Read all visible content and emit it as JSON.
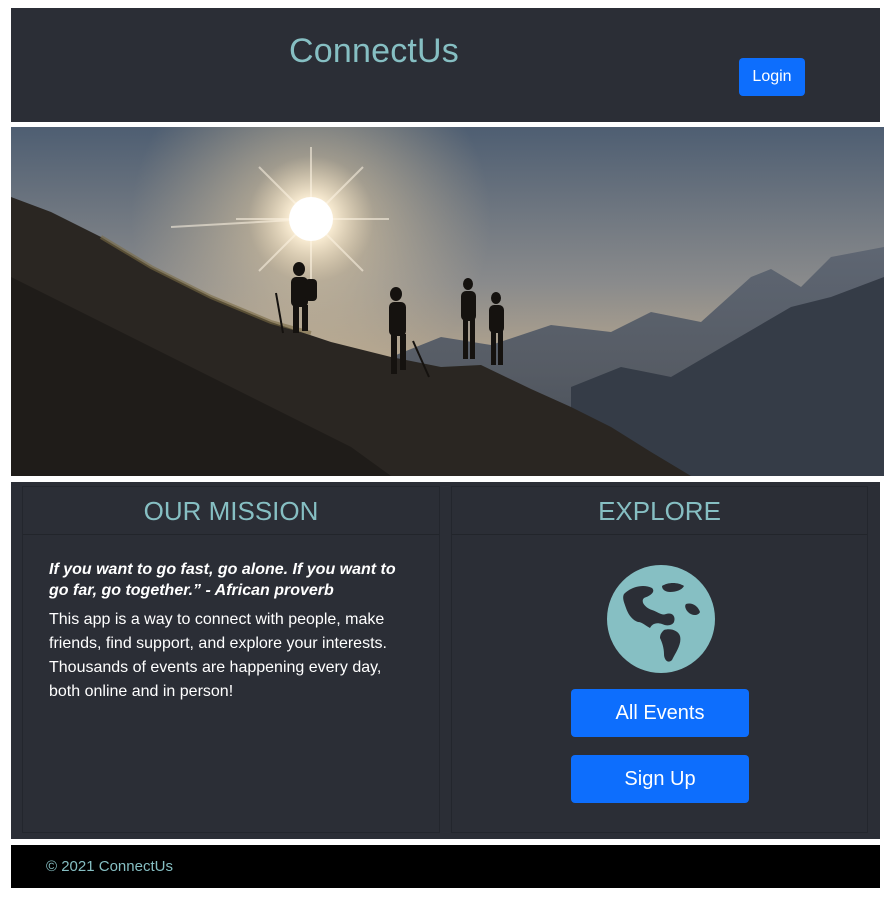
{
  "header": {
    "brand": "ConnectUs",
    "login_label": "Login"
  },
  "hero": {
    "image": "hikers-silhouette-mountain-sunrise"
  },
  "mission": {
    "title": "OUR MISSION",
    "quote": "If you want to go fast, go alone. If you want to go far, go together.” - African proverb",
    "text": "This app is a way to connect with people, make friends, find support, and explore your interests. Thousands of events are happening every day, both online and in person!"
  },
  "explore": {
    "title": "EXPLORE",
    "icon": "globe-icon",
    "all_events_label": "All Events",
    "signup_label": "Sign Up"
  },
  "footer": {
    "text": "© 2021 ConnectUs"
  },
  "colors": {
    "background": "#2b2e36",
    "accent": "#86bfc3",
    "button": "#0d6efd",
    "footer": "#000000"
  }
}
